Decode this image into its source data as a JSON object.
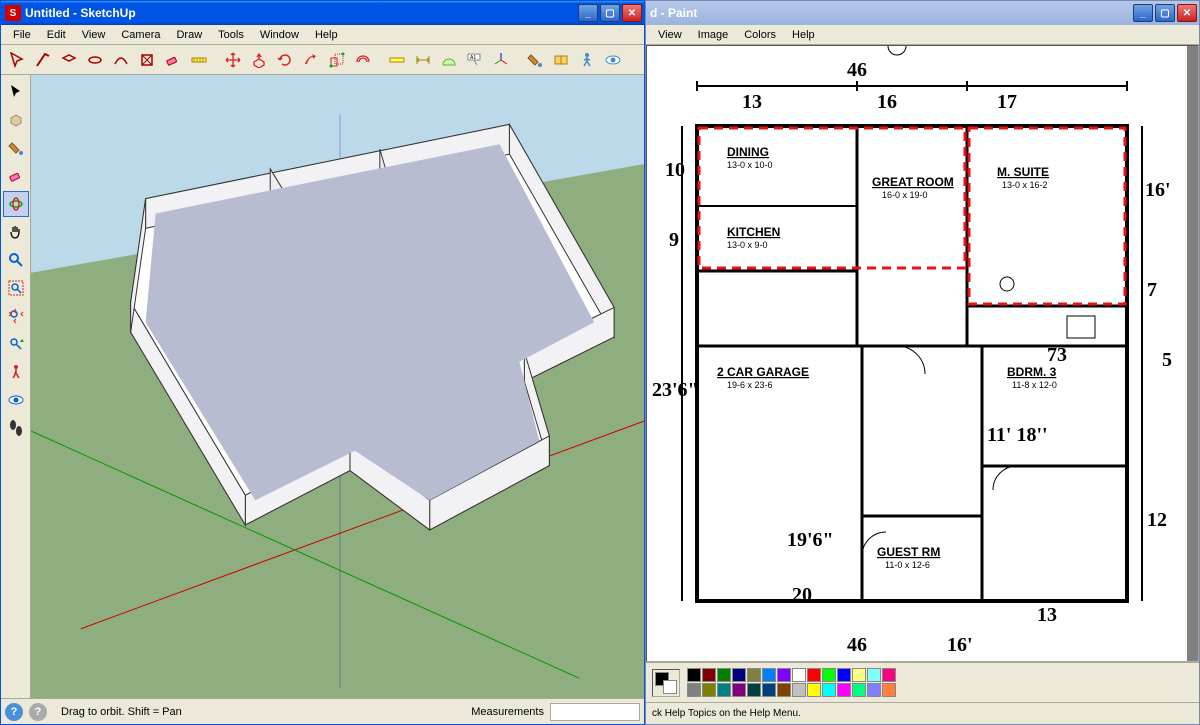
{
  "sketchup": {
    "title": "Untitled - SketchUp",
    "menus": [
      "File",
      "Edit",
      "View",
      "Camera",
      "Draw",
      "Tools",
      "Window",
      "Help"
    ],
    "toolbar_top": [
      "select",
      "line",
      "rectangle",
      "circle",
      "arc",
      "polygon",
      "freehand",
      "eraser",
      "tape",
      "move",
      "rotate",
      "scale",
      "offset",
      "pushpull",
      "followme",
      "paint",
      "orbit",
      "protractor",
      "dimension",
      "text",
      "3dtext",
      "section",
      "axes",
      "walk",
      "lookaround"
    ],
    "toolbar_left": [
      "select-tool",
      "component-tool",
      "paint-tool",
      "eraser-tool",
      "orbit-tool",
      "pan-tool",
      "zoom-tool",
      "zoom-window-tool",
      "zoom-extents-tool",
      "previous-tool",
      "walk-tool",
      "lookaround-tool",
      "position-tool",
      "shadows-tool"
    ],
    "status_hint": "Drag to orbit.  Shift = Pan",
    "measurements_label": "Measurements",
    "measurements_value": ""
  },
  "paint": {
    "title": "d - Paint",
    "menus": [
      "View",
      "Image",
      "Colors",
      "Help"
    ],
    "status_hint": "ck Help Topics on the Help Menu.",
    "palette": [
      "#000000",
      "#808080",
      "#800000",
      "#808000",
      "#008000",
      "#008080",
      "#000080",
      "#800080",
      "#808040",
      "#004040",
      "#0080ff",
      "#004080",
      "#8000ff",
      "#804000",
      "#ffffff",
      "#c0c0c0",
      "#ff0000",
      "#ffff00",
      "#00ff00",
      "#00ffff",
      "#0000ff",
      "#ff00ff",
      "#ffff80",
      "#00ff80",
      "#80ffff",
      "#8080ff",
      "#ff0080",
      "#ff8040"
    ]
  },
  "floorplan": {
    "rooms": [
      {
        "name": "DINING",
        "dims": "13-0 x 10-0"
      },
      {
        "name": "GREAT ROOM",
        "dims": "16-0 x 19-0"
      },
      {
        "name": "M. SUITE",
        "dims": "13-0 x 16-2"
      },
      {
        "name": "KITCHEN",
        "dims": "13-0 x 9-0"
      },
      {
        "name": "2 CAR GARAGE",
        "dims": "19-6 x 23-6"
      },
      {
        "name": "BDRM. 3",
        "dims": "11-8 x 12-0"
      },
      {
        "name": "GUEST RM",
        "dims": "11-0 x 12-6"
      }
    ],
    "handwritten": [
      "46",
      "13",
      "16",
      "17",
      "10",
      "9",
      "16'",
      "7",
      "23'6\"",
      "5",
      "73",
      "11' 18''",
      "19'6\"",
      "20",
      "12",
      "13",
      "46",
      "16'"
    ]
  }
}
